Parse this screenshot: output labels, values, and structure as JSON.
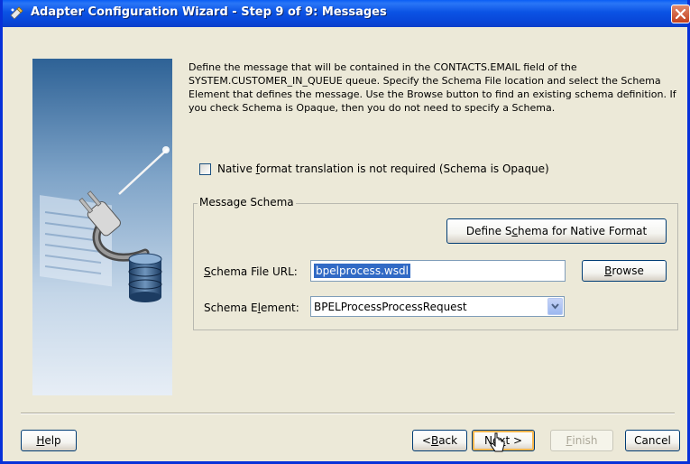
{
  "window": {
    "title": "Adapter Configuration Wizard - Step 9 of 9: Messages",
    "icon": "wizard-icon",
    "close_icon": "close-icon"
  },
  "description": "Define the message that will be contained in the CONTACTS.EMAIL field of the SYSTEM.CUSTOMER_IN_QUEUE queue.  Specify the Schema File location and select the Schema Element that defines the message. Use the Browse button to find an existing schema definition. If you check Schema is Opaque, then you do not need to specify a Schema.",
  "opaque_checkbox": {
    "label_pre": "Native ",
    "label_mnemonic": "f",
    "label_post": "ormat translation is not required (Schema is Opaque)",
    "checked": false
  },
  "message_schema": {
    "legend": "Message Schema",
    "define_button": {
      "pre": "Define S",
      "mnemonic": "c",
      "post": "hema for Native Format"
    },
    "schema_file_label": {
      "pre": "",
      "mnemonic": "S",
      "post": "chema File URL:"
    },
    "schema_file_value": "bpelprocess.wsdl",
    "browse_button": {
      "pre": "",
      "mnemonic": "B",
      "post": "rowse"
    },
    "schema_element_label": {
      "pre": "Schema E",
      "mnemonic": "l",
      "post": "ement:"
    },
    "schema_element_value": "BPELProcessProcessRequest"
  },
  "buttons": {
    "help": {
      "pre": "",
      "mnemonic": "H",
      "post": "elp"
    },
    "back": {
      "pre": "< ",
      "mnemonic": "B",
      "post": "ack"
    },
    "next": {
      "pre": "Ne",
      "mnemonic": "x",
      "post": "t >"
    },
    "finish": {
      "pre": "",
      "mnemonic": "F",
      "post": "inish"
    },
    "cancel": {
      "pre": "",
      "mnemonic": "",
      "post": "Cancel"
    }
  },
  "colors": {
    "titlebar": "#0b53e4",
    "dialog_bg": "#ece9d8",
    "selection": "#316ac5"
  }
}
